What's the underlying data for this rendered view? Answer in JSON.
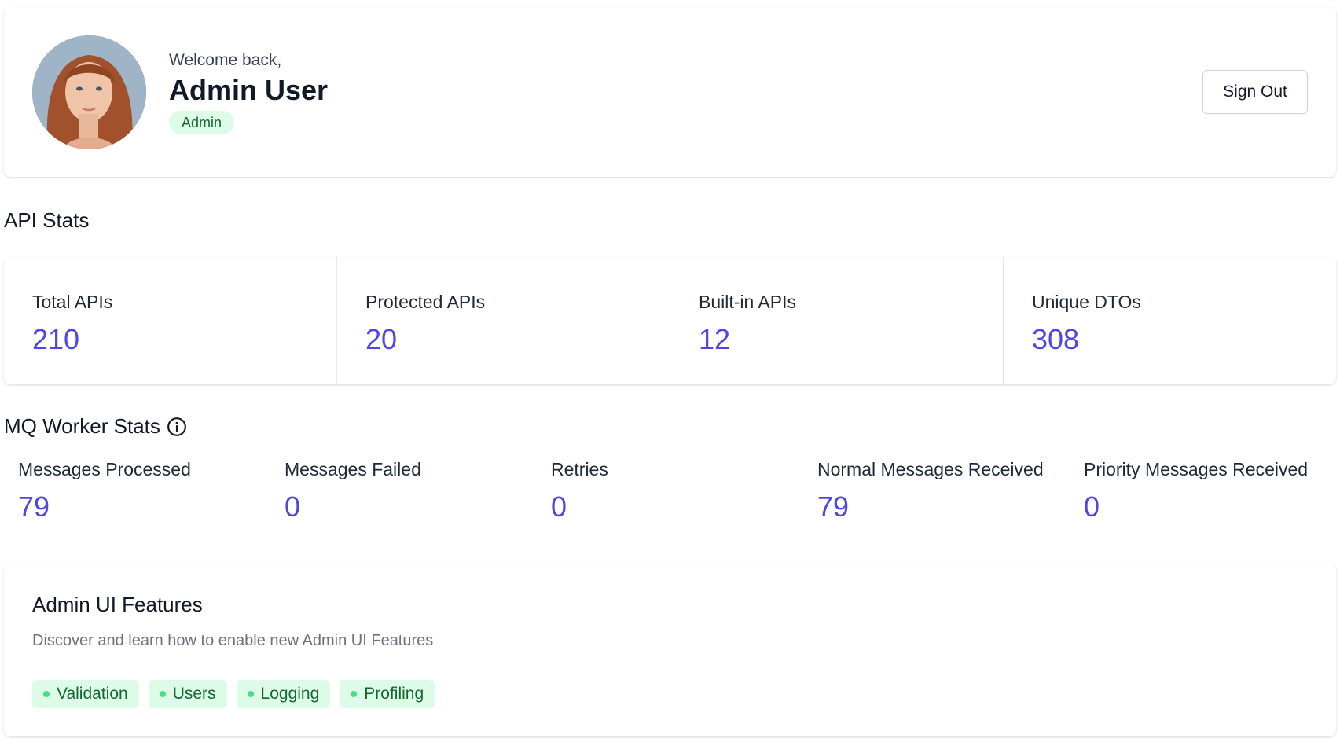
{
  "profile": {
    "welcome": "Welcome back,",
    "name": "Admin User",
    "role": "Admin",
    "sign_out": "Sign Out"
  },
  "api_stats": {
    "title": "API Stats",
    "items": [
      {
        "label": "Total APIs",
        "value": "210"
      },
      {
        "label": "Protected APIs",
        "value": "20"
      },
      {
        "label": "Built-in APIs",
        "value": "12"
      },
      {
        "label": "Unique DTOs",
        "value": "308"
      }
    ]
  },
  "mq_stats": {
    "title": "MQ Worker Stats",
    "info_icon": "info-icon",
    "items": [
      {
        "label": "Messages Processed",
        "value": "79"
      },
      {
        "label": "Messages Failed",
        "value": "0"
      },
      {
        "label": "Retries",
        "value": "0"
      },
      {
        "label": "Normal Messages Received",
        "value": "79"
      },
      {
        "label": "Priority Messages Received",
        "value": "0"
      }
    ]
  },
  "features": {
    "title": "Admin UI Features",
    "description": "Discover and learn how to enable new Admin UI Features",
    "tags": [
      "Validation",
      "Users",
      "Logging",
      "Profiling"
    ]
  },
  "colors": {
    "accent": "#4f46e5",
    "badge_bg": "#dcfce7",
    "badge_text": "#166534",
    "tag_dot": "#4ade80"
  }
}
